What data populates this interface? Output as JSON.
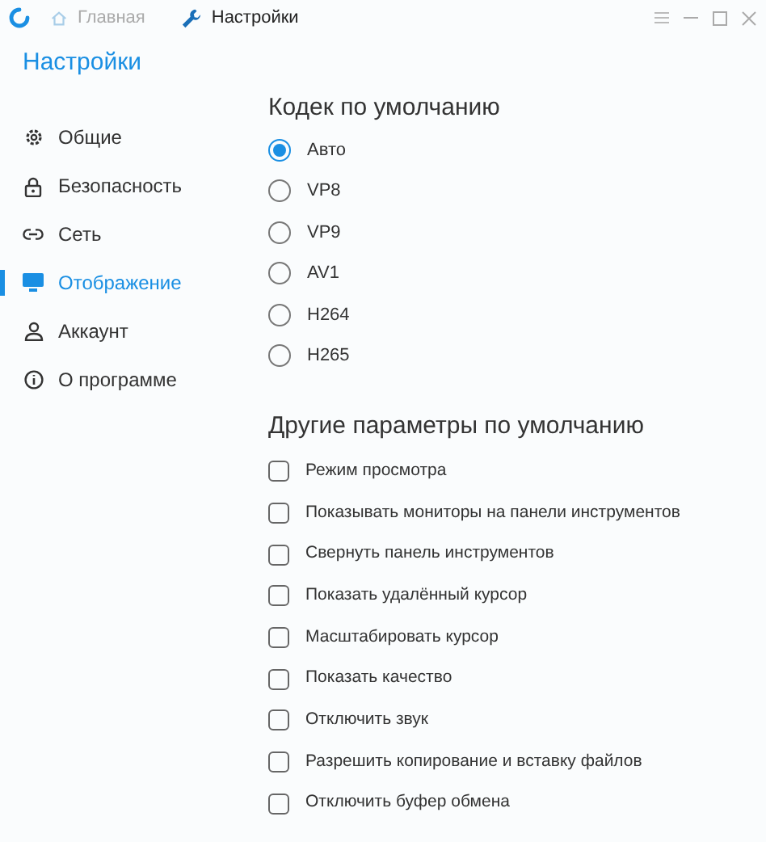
{
  "tabs": [
    {
      "label": "Главная",
      "selected": false
    },
    {
      "label": "Настройки",
      "selected": true
    }
  ],
  "sidebar": {
    "title": "Настройки",
    "items": [
      {
        "label": "Общие",
        "selected": false
      },
      {
        "label": "Безопасность",
        "selected": false
      },
      {
        "label": "Сеть",
        "selected": false
      },
      {
        "label": "Отображение",
        "selected": true
      },
      {
        "label": "Аккаунт",
        "selected": false
      },
      {
        "label": "О программе",
        "selected": false
      }
    ]
  },
  "codec": {
    "heading": "Кодек по умолчанию",
    "options": [
      {
        "label": "Авто",
        "selected": true
      },
      {
        "label": "VP8",
        "selected": false
      },
      {
        "label": "VP9",
        "selected": false
      },
      {
        "label": "AV1",
        "selected": false
      },
      {
        "label": "H264",
        "selected": false
      },
      {
        "label": "H265",
        "selected": false
      }
    ]
  },
  "other": {
    "heading": "Другие параметры по умолчанию",
    "options": [
      {
        "label": "Режим просмотра",
        "checked": false
      },
      {
        "label": "Показывать мониторы на панели инструментов",
        "checked": false
      },
      {
        "label": "Свернуть панель инструментов",
        "checked": false
      },
      {
        "label": "Показать удалённый курсор",
        "checked": false
      },
      {
        "label": "Масштабировать курсор",
        "checked": false
      },
      {
        "label": "Показать качество",
        "checked": false
      },
      {
        "label": "Отключить звук",
        "checked": false
      },
      {
        "label": "Разрешить копирование и вставку файлов",
        "checked": false
      },
      {
        "label": "Отключить буфер обмена",
        "checked": false
      }
    ]
  }
}
